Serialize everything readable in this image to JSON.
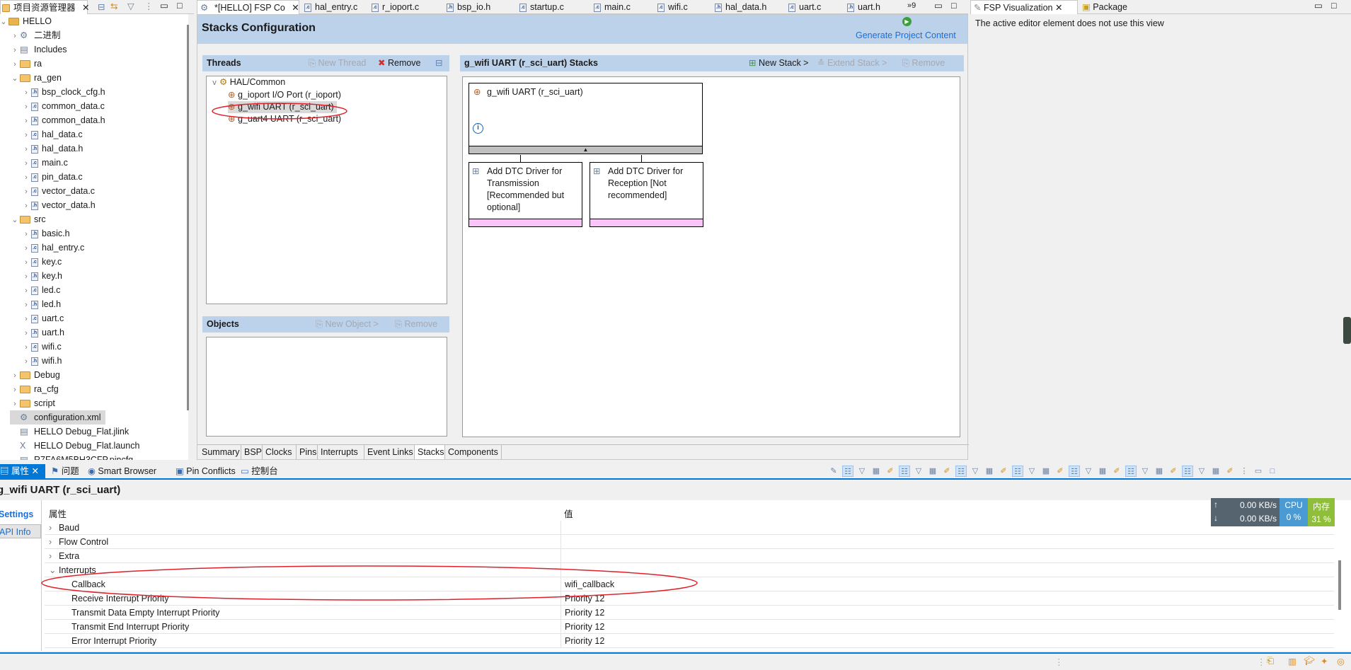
{
  "explorer": {
    "title": "项目资源管理器",
    "tree": [
      {
        "label": "HELLO",
        "level": 0,
        "arrow": "v",
        "icon": "project"
      },
      {
        "label": "二进制",
        "level": 1,
        "arrow": ">",
        "icon": "binary"
      },
      {
        "label": "Includes",
        "level": 1,
        "arrow": ">",
        "icon": "includes"
      },
      {
        "label": "ra",
        "level": 1,
        "arrow": ">",
        "icon": "folder"
      },
      {
        "label": "ra_gen",
        "level": 1,
        "arrow": "v",
        "icon": "folder"
      },
      {
        "label": "bsp_clock_cfg.h",
        "level": 2,
        "arrow": ">",
        "icon": "h"
      },
      {
        "label": "common_data.c",
        "level": 2,
        "arrow": ">",
        "icon": "c"
      },
      {
        "label": "common_data.h",
        "level": 2,
        "arrow": ">",
        "icon": "h"
      },
      {
        "label": "hal_data.c",
        "level": 2,
        "arrow": ">",
        "icon": "c"
      },
      {
        "label": "hal_data.h",
        "level": 2,
        "arrow": ">",
        "icon": "h"
      },
      {
        "label": "main.c",
        "level": 2,
        "arrow": ">",
        "icon": "c"
      },
      {
        "label": "pin_data.c",
        "level": 2,
        "arrow": ">",
        "icon": "c"
      },
      {
        "label": "vector_data.c",
        "level": 2,
        "arrow": ">",
        "icon": "c"
      },
      {
        "label": "vector_data.h",
        "level": 2,
        "arrow": ">",
        "icon": "h"
      },
      {
        "label": "src",
        "level": 1,
        "arrow": "v",
        "icon": "folder"
      },
      {
        "label": "basic.h",
        "level": 2,
        "arrow": ">",
        "icon": "h"
      },
      {
        "label": "hal_entry.c",
        "level": 2,
        "arrow": ">",
        "icon": "c"
      },
      {
        "label": "key.c",
        "level": 2,
        "arrow": ">",
        "icon": "c"
      },
      {
        "label": "key.h",
        "level": 2,
        "arrow": ">",
        "icon": "h"
      },
      {
        "label": "led.c",
        "level": 2,
        "arrow": ">",
        "icon": "c"
      },
      {
        "label": "led.h",
        "level": 2,
        "arrow": ">",
        "icon": "h"
      },
      {
        "label": "uart.c",
        "level": 2,
        "arrow": ">",
        "icon": "c"
      },
      {
        "label": "uart.h",
        "level": 2,
        "arrow": ">",
        "icon": "h"
      },
      {
        "label": "wifi.c",
        "level": 2,
        "arrow": ">",
        "icon": "c"
      },
      {
        "label": "wifi.h",
        "level": 2,
        "arrow": ">",
        "icon": "h"
      },
      {
        "label": "Debug",
        "level": 1,
        "arrow": ">",
        "icon": "folder"
      },
      {
        "label": "ra_cfg",
        "level": 1,
        "arrow": ">",
        "icon": "folder"
      },
      {
        "label": "script",
        "level": 1,
        "arrow": ">",
        "icon": "folder"
      },
      {
        "label": "configuration.xml",
        "level": 1,
        "arrow": "",
        "icon": "gear",
        "selected": true
      },
      {
        "label": "HELLO Debug_Flat.jlink",
        "level": 1,
        "arrow": "",
        "icon": "doc"
      },
      {
        "label": "HELLO Debug_Flat.launch",
        "level": 1,
        "arrow": "",
        "icon": "x"
      },
      {
        "label": "R7FA6M5BH3CFP.pincfg",
        "level": 1,
        "arrow": "",
        "icon": "doc"
      }
    ]
  },
  "editor_tabs": [
    {
      "label": "*[HELLO] FSP Co",
      "icon": "gear",
      "active": true
    },
    {
      "label": "hal_entry.c",
      "icon": "c"
    },
    {
      "label": "r_ioport.c",
      "icon": "c"
    },
    {
      "label": "bsp_io.h",
      "icon": "h"
    },
    {
      "label": "startup.c",
      "icon": "c"
    },
    {
      "label": "main.c",
      "icon": "c"
    },
    {
      "label": "wifi.c",
      "icon": "c"
    },
    {
      "label": "hal_data.h",
      "icon": "h"
    },
    {
      "label": "uart.c",
      "icon": "c"
    },
    {
      "label": "uart.h",
      "icon": "h"
    }
  ],
  "editor_overflow": "»9",
  "fsp": {
    "title": "Stacks Configuration",
    "generate": "Generate Project Content",
    "threads": {
      "title": "Threads",
      "new_thread": "New Thread",
      "remove": "Remove",
      "root": "HAL/Common",
      "items": [
        "g_ioport I/O Port (r_ioport)",
        "g_wifi UART (r_sci_uart)",
        "g_uart4 UART (r_sci_uart)"
      ]
    },
    "objects": {
      "title": "Objects",
      "new_object": "New Object >",
      "remove": "Remove"
    },
    "stacks": {
      "title": "g_wifi UART (r_sci_uart) Stacks",
      "new_stack": "New Stack >",
      "extend_stack": "Extend Stack >",
      "remove": "Remove",
      "module": "g_wifi UART (r_sci_uart)",
      "children": [
        "Add DTC Driver for Transmission [Recommended but optional]",
        "Add DTC Driver for Reception [Not recommended]"
      ]
    },
    "bottom_tabs": [
      "Summary",
      "BSP",
      "Clocks",
      "Pins",
      "Interrupts",
      "Event Links",
      "Stacks",
      "Components"
    ],
    "active_bottom_tab": "Stacks"
  },
  "right_panel": {
    "tabs": [
      "FSP Visualization",
      "Package"
    ],
    "message": "The active editor element does not use this view"
  },
  "bottom_panel": {
    "tabs": [
      "属性",
      "问题",
      "Smart Browser",
      "Pin Conflicts",
      "控制台"
    ],
    "title": "g_wifi UART (r_sci_uart)",
    "side_tabs": [
      "Settings",
      "API Info"
    ],
    "columns": [
      "属性",
      "值"
    ],
    "rows": [
      {
        "name": "Baud",
        "value": "",
        "level": 0,
        "arrow": ">"
      },
      {
        "name": "Flow Control",
        "value": "",
        "level": 0,
        "arrow": ">"
      },
      {
        "name": "Extra",
        "value": "",
        "level": 0,
        "arrow": ">"
      },
      {
        "name": "Interrupts",
        "value": "",
        "level": 0,
        "arrow": "v"
      },
      {
        "name": "Callback",
        "value": "wifi_callback",
        "level": 1,
        "arrow": ""
      },
      {
        "name": "Receive Interrupt Priority",
        "value": "Priority 12",
        "level": 1,
        "arrow": ""
      },
      {
        "name": "Transmit Data Empty Interrupt Priority",
        "value": "Priority 12",
        "level": 1,
        "arrow": ""
      },
      {
        "name": "Transmit End Interrupt Priority",
        "value": "Priority 12",
        "level": 1,
        "arrow": ""
      },
      {
        "name": "Error Interrupt Priority",
        "value": "Priority 12",
        "level": 1,
        "arrow": ""
      }
    ]
  },
  "monitor": {
    "up": "0.00 KB/s",
    "down": "0.00 KB/s",
    "cpu_label": "CPU",
    "cpu": "0 %",
    "mem_label": "内存",
    "mem": "31 %"
  },
  "colors": {
    "header_blue": "#bcd1ea",
    "accent": "#0078d7",
    "highlight_red": "#e0202a",
    "pink": "#fbc4f8",
    "cpu": "#4a9ad4",
    "mem": "#8fbf3a",
    "net": "#56646f"
  }
}
